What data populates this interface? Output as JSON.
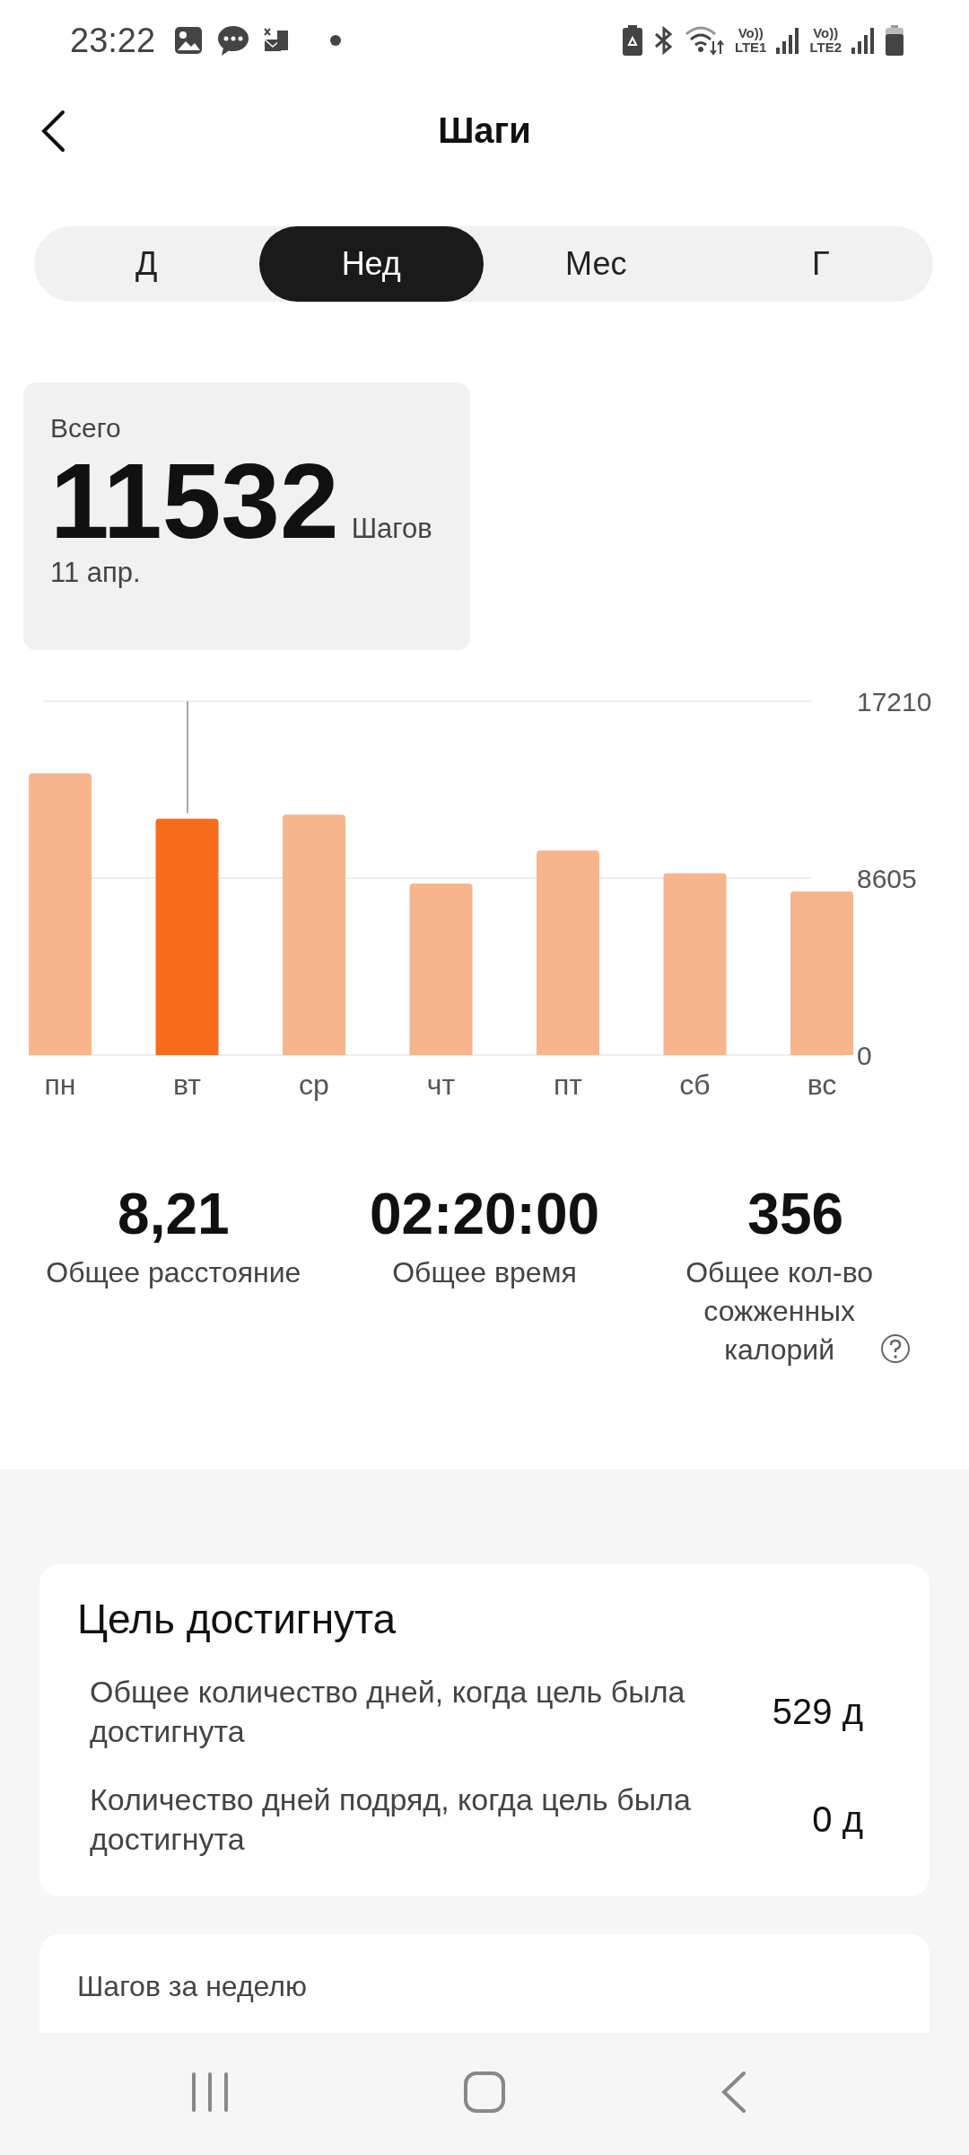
{
  "status_bar": {
    "time": "23:22",
    "sims": [
      {
        "volte": "Vo))",
        "network": "LTE1"
      },
      {
        "volte": "Vo))",
        "network": "LTE2"
      }
    ]
  },
  "header": {
    "title": "Шаги"
  },
  "tabs": [
    {
      "label": "Д",
      "selected": false
    },
    {
      "label": "Нед",
      "selected": true
    },
    {
      "label": "Мес",
      "selected": false
    },
    {
      "label": "Г",
      "selected": false
    }
  ],
  "summary": {
    "caption": "Всего",
    "value": "11532",
    "unit": "Шагов",
    "date": "11 апр."
  },
  "chart": {
    "chart_data": {
      "type": "bar",
      "categories": [
        "пн",
        "вт",
        "ср",
        "чт",
        "пт",
        "сб",
        "вс"
      ],
      "values": [
        13700,
        11500,
        11690,
        8340,
        9950,
        8840,
        7960
      ],
      "ylim": [
        0,
        17210
      ],
      "yticks": [
        0,
        8605,
        17210
      ]
    },
    "bars": [
      {
        "selected": false
      },
      {
        "selected": true
      },
      {
        "selected": false
      },
      {
        "selected": false
      },
      {
        "selected": false
      },
      {
        "selected": false
      },
      {
        "selected": false
      }
    ]
  },
  "stats": [
    {
      "value": "8,21",
      "label": "Общее расстояние",
      "help": false
    },
    {
      "value": "02:20:00",
      "label": "Общее время",
      "help": false
    },
    {
      "value": "356",
      "label": "Общее кол-во сожженных калорий",
      "help": true
    }
  ],
  "goal_card": {
    "title": "Цель достигнута",
    "rows": [
      {
        "label": "Общее количество дней, когда цель была достигнута",
        "value": "529 д"
      },
      {
        "label": "Количество дней подряд, когда цель была достигнута",
        "value": "0 д"
      }
    ]
  },
  "weekly_card": {
    "title": "Шагов за неделю"
  }
}
